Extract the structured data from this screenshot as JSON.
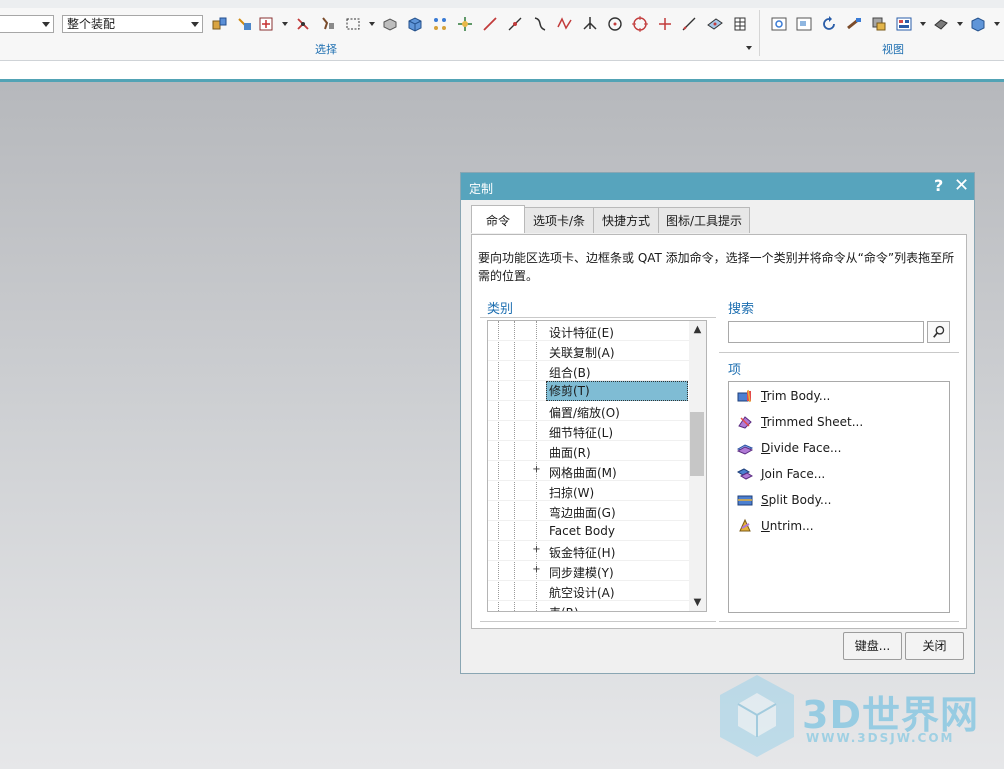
{
  "ribbon": {
    "filter_value": "",
    "assembly_scope_value": "整个装配",
    "select_group_label": "选择",
    "view_group_label": "视图"
  },
  "dialog": {
    "title": "定制",
    "help_glyph": "?",
    "close_glyph": "✕",
    "tabs": [
      {
        "label": "命令",
        "active": true
      },
      {
        "label": "选项卡/条",
        "active": false
      },
      {
        "label": "快捷方式",
        "active": false
      },
      {
        "label": "图标/工具提示",
        "active": false
      }
    ],
    "instructions": "要向功能区选项卡、边框条或 QAT 添加命令，选择一个类别并将命令从“命令”列表拖至所需的位置。",
    "category_label": "类别",
    "search_label": "搜索",
    "search_value": "",
    "items_label": "项",
    "categories": [
      {
        "label": "设计特征(E)",
        "expand": false,
        "selected": false
      },
      {
        "label": "关联复制(A)",
        "expand": false,
        "selected": false
      },
      {
        "label": "组合(B)",
        "expand": false,
        "selected": false
      },
      {
        "label": "修剪(T)",
        "expand": false,
        "selected": true
      },
      {
        "label": "偏置/缩放(O)",
        "expand": false,
        "selected": false
      },
      {
        "label": "细节特征(L)",
        "expand": false,
        "selected": false
      },
      {
        "label": "曲面(R)",
        "expand": false,
        "selected": false
      },
      {
        "label": "网格曲面(M)",
        "expand": true,
        "selected": false
      },
      {
        "label": "扫掠(W)",
        "expand": false,
        "selected": false
      },
      {
        "label": "弯边曲面(G)",
        "expand": false,
        "selected": false
      },
      {
        "label": "Facet Body",
        "expand": false,
        "selected": false
      },
      {
        "label": "钣金特征(H)",
        "expand": true,
        "selected": false
      },
      {
        "label": "同步建模(Y)",
        "expand": true,
        "selected": false
      },
      {
        "label": "航空设计(A)",
        "expand": false,
        "selected": false
      },
      {
        "label": "表(R)",
        "expand": false,
        "selected": false
      }
    ],
    "items": [
      {
        "first": "T",
        "rest": "rim Body...",
        "icon": "trim-body-icon"
      },
      {
        "first": "T",
        "rest": "rimmed Sheet...",
        "icon": "trimmed-sheet-icon"
      },
      {
        "first": "D",
        "rest": "ivide Face...",
        "icon": "divide-face-icon"
      },
      {
        "first": "J",
        "rest": "oin Face...",
        "icon": "join-face-icon"
      },
      {
        "first": "S",
        "rest": "plit Body...",
        "icon": "split-body-icon"
      },
      {
        "first": "U",
        "rest": "ntrim...",
        "icon": "untrim-icon"
      }
    ],
    "keyboard_button": "键盘...",
    "close_button": "关闭"
  },
  "watermark": {
    "brand": "3D世界网",
    "url": "WWW.3DSJW.COM"
  },
  "colors": {
    "titlebar": "#57a4bd",
    "selection": "#7fbcd4",
    "section_label": "#1e6fb1"
  }
}
